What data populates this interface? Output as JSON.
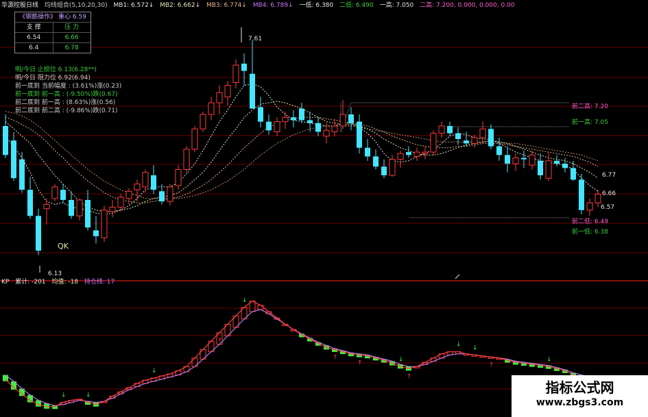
{
  "header": {
    "app": "华源控股日线",
    "formula": "均线组合(5,10,20,30)",
    "ma1": "MB1: 6.572↓",
    "ma2": "MB2: 6.662↓",
    "ma3": "MB3: 6.774↓",
    "ma4": "MB4: 6.789↓",
    "sup1": "一低: 6.380",
    "sup2": "二低: 6.490",
    "res1": "一高: 7.050",
    "res2": "二高: 7.200, 0.000, 0.000, 0.00"
  },
  "infobox": {
    "title": "《钢筋操作》 重心 6.59",
    "col_support": "支 撑",
    "col_pressure": "压 力",
    "rows": [
      [
        "6.54",
        "6.66"
      ],
      [
        "6.4",
        "6.78"
      ]
    ]
  },
  "notes": [
    {
      "text": "明/今日  止损位  6.13(6.28**)",
      "color": "#3ccf3c"
    },
    {
      "text": "明/今日  阻力位  6.92(6.94)",
      "color": "#d0d0d0"
    },
    {
      "text": "前一底到 当前幅度  : (3.61%)涨(0.23)",
      "color": "#d0d0d0"
    },
    {
      "text": "前一底到 前一高  : (-9.50%)跌(0.67)",
      "color": "#3ccf3c"
    },
    {
      "text": "前二底到 前一高  : (8.63%)涨(0.56)",
      "color": "#d0d0d0"
    },
    {
      "text": "前二底到 前二高  : (-9.86%)跌(0.71)",
      "color": "#d0d0d0"
    }
  ],
  "markers": {
    "peak": "7.61",
    "low": "6.13",
    "qk": "QK",
    "prev2_high": "前二高: 7.20",
    "prev1_high": "前一高: 7.05",
    "prev2_low": "前二低: 6.49",
    "prev1_low": "前一低: 6.38",
    "r1": "6.77",
    "r2": "6.66",
    "r3": "6.57"
  },
  "lower": {
    "name": "KP",
    "label1": "累计: -201",
    "label2": "均值: -18",
    "label3": "持仓线: 17"
  },
  "watermark": {
    "line1": "指标公式网",
    "line2": "www.zbgs3.com"
  },
  "colors": {
    "up": "#ff3c3c",
    "down": "#44e6ff",
    "ma_white": "#e6e6e6",
    "ma_yellow": "#e6e6b4",
    "ma_orange": "#e6b48c",
    "ma_brown": "#c88c64",
    "grid": "#6a0000",
    "osc_green": "#3cf03c",
    "osc_red": "#ff3c3c",
    "osc_purple": "#b478e6"
  },
  "chart_data": {
    "type": "candlestick",
    "ylim": [
      6.0,
      7.7
    ],
    "ohlc": [
      [
        7.02,
        7.1,
        6.8,
        6.82
      ],
      [
        6.92,
        6.98,
        6.64,
        6.66
      ],
      [
        6.79,
        6.84,
        6.56,
        6.58
      ],
      [
        6.58,
        6.67,
        6.38,
        6.4
      ],
      [
        6.4,
        6.45,
        6.13,
        6.16
      ],
      [
        6.45,
        6.52,
        6.34,
        6.48
      ],
      [
        6.52,
        6.62,
        6.5,
        6.6
      ],
      [
        6.58,
        6.62,
        6.49,
        6.51
      ],
      [
        6.51,
        6.57,
        6.38,
        6.4
      ],
      [
        6.4,
        6.52,
        6.37,
        6.51
      ],
      [
        6.51,
        6.58,
        6.3,
        6.32
      ],
      [
        6.3,
        6.4,
        6.21,
        6.26
      ],
      [
        6.25,
        6.47,
        6.22,
        6.44
      ],
      [
        6.43,
        6.51,
        6.39,
        6.46
      ],
      [
        6.46,
        6.55,
        6.43,
        6.53
      ],
      [
        6.52,
        6.59,
        6.48,
        6.57
      ],
      [
        6.58,
        6.65,
        6.5,
        6.62
      ],
      [
        6.6,
        6.72,
        6.56,
        6.7
      ],
      [
        6.68,
        6.75,
        6.55,
        6.58
      ],
      [
        6.57,
        6.62,
        6.48,
        6.5
      ],
      [
        6.5,
        6.62,
        6.47,
        6.6
      ],
      [
        6.61,
        6.75,
        6.58,
        6.72
      ],
      [
        6.72,
        6.88,
        6.7,
        6.86
      ],
      [
        6.86,
        7.02,
        6.84,
        7.0
      ],
      [
        7.0,
        7.12,
        6.98,
        7.1
      ],
      [
        7.1,
        7.22,
        7.06,
        7.18
      ],
      [
        7.18,
        7.3,
        7.1,
        7.25
      ],
      [
        7.22,
        7.33,
        7.16,
        7.3
      ],
      [
        7.32,
        7.48,
        7.28,
        7.44
      ],
      [
        7.45,
        7.52,
        7.3,
        7.4
      ],
      [
        7.38,
        7.61,
        7.3,
        7.14
      ],
      [
        7.15,
        7.22,
        7.01,
        7.05
      ],
      [
        7.05,
        7.1,
        6.96,
        6.99
      ],
      [
        6.98,
        7.08,
        6.95,
        7.05
      ],
      [
        7.05,
        7.12,
        7.0,
        7.08
      ],
      [
        7.08,
        7.13,
        7.01,
        7.06
      ],
      [
        7.14,
        7.18,
        7.04,
        7.06
      ],
      [
        7.06,
        7.12,
        6.98,
        7.04
      ],
      [
        7.04,
        7.08,
        6.95,
        6.98
      ],
      [
        6.95,
        7.04,
        6.9,
        6.99
      ],
      [
        6.98,
        7.07,
        6.95,
        7.02
      ],
      [
        7.02,
        7.2,
        7.0,
        7.1
      ],
      [
        7.1,
        7.15,
        6.99,
        7.04
      ],
      [
        7.05,
        7.1,
        6.83,
        6.87
      ],
      [
        6.87,
        6.93,
        6.78,
        6.81
      ],
      [
        6.81,
        6.86,
        6.72,
        6.74
      ],
      [
        6.74,
        6.79,
        6.66,
        6.68
      ],
      [
        6.68,
        6.82,
        6.67,
        6.79
      ],
      [
        6.79,
        6.85,
        6.73,
        6.83
      ],
      [
        6.84,
        6.88,
        6.8,
        6.82
      ],
      [
        6.81,
        6.87,
        6.78,
        6.84
      ],
      [
        6.83,
        6.88,
        6.79,
        6.84
      ],
      [
        6.84,
        6.99,
        6.82,
        6.97
      ],
      [
        6.97,
        7.05,
        6.94,
        7.02
      ],
      [
        7.02,
        7.05,
        6.95,
        6.97
      ],
      [
        6.97,
        7.01,
        6.89,
        6.93
      ],
      [
        6.92,
        6.98,
        6.88,
        6.9
      ],
      [
        6.9,
        6.96,
        6.87,
        6.94
      ],
      [
        6.94,
        7.05,
        6.9,
        7.0
      ],
      [
        7.0,
        7.03,
        6.86,
        6.88
      ],
      [
        6.88,
        6.94,
        6.78,
        6.82
      ],
      [
        6.82,
        6.88,
        6.7,
        6.76
      ],
      [
        6.76,
        6.83,
        6.71,
        6.8
      ],
      [
        6.8,
        6.85,
        6.73,
        6.79
      ],
      [
        6.75,
        6.85,
        6.72,
        6.82
      ],
      [
        6.78,
        6.83,
        6.65,
        6.68
      ],
      [
        6.66,
        6.84,
        6.64,
        6.78
      ],
      [
        6.78,
        6.82,
        6.74,
        6.76
      ],
      [
        6.76,
        6.8,
        6.7,
        6.73
      ],
      [
        6.73,
        6.78,
        6.64,
        6.65
      ],
      [
        6.65,
        6.69,
        6.41,
        6.44
      ],
      [
        6.44,
        6.52,
        6.4,
        6.49
      ],
      [
        6.49,
        6.58,
        6.46,
        6.55
      ]
    ],
    "ma_white": [
      6.95,
      6.88,
      6.8,
      6.7,
      6.58,
      6.5,
      6.48,
      6.49,
      6.46,
      6.45,
      6.44,
      6.42,
      6.41,
      6.42,
      6.44,
      6.47,
      6.52,
      6.58,
      6.6,
      6.6,
      6.6,
      6.63,
      6.69,
      6.76,
      6.85,
      6.95,
      7.05,
      7.13,
      7.22,
      7.3,
      7.31,
      7.29,
      7.23,
      7.15,
      7.1,
      7.06,
      7.05,
      7.04,
      7.03,
      7.02,
      7.02,
      7.04,
      7.04,
      7.01,
      6.97,
      6.91,
      6.83,
      6.78,
      6.77,
      6.78,
      6.81,
      6.83,
      6.86,
      6.9,
      6.95,
      6.97,
      6.96,
      6.94,
      6.93,
      6.93,
      6.9,
      6.87,
      6.84,
      6.82,
      6.8,
      6.78,
      6.77,
      6.76,
      6.75,
      6.72,
      6.66,
      6.61,
      6.57
    ],
    "ma_yellow": [
      7.05,
      7.0,
      6.95,
      6.9,
      6.82,
      6.75,
      6.68,
      6.62,
      6.56,
      6.5,
      6.46,
      6.44,
      6.43,
      6.43,
      6.44,
      6.45,
      6.47,
      6.5,
      6.52,
      6.53,
      6.54,
      6.56,
      6.6,
      6.65,
      6.7,
      6.77,
      6.85,
      6.93,
      7.0,
      7.08,
      7.13,
      7.17,
      7.18,
      7.19,
      7.18,
      7.16,
      7.14,
      7.11,
      7.08,
      7.05,
      7.04,
      7.03,
      7.03,
      7.02,
      7.0,
      6.97,
      6.93,
      6.9,
      6.87,
      6.85,
      6.83,
      6.82,
      6.82,
      6.83,
      6.85,
      6.87,
      6.89,
      6.9,
      6.91,
      6.92,
      6.91,
      6.9,
      6.88,
      6.86,
      6.84,
      6.82,
      6.8,
      6.79,
      6.78,
      6.76,
      6.73,
      6.7,
      6.66
    ],
    "ma_orange": [
      7.08,
      7.06,
      7.03,
      7.0,
      6.96,
      6.91,
      6.85,
      6.8,
      6.74,
      6.69,
      6.64,
      6.6,
      6.56,
      6.53,
      6.51,
      6.5,
      6.49,
      6.49,
      6.5,
      6.51,
      6.52,
      6.53,
      6.55,
      6.58,
      6.61,
      6.65,
      6.7,
      6.75,
      6.81,
      6.87,
      6.92,
      6.97,
      7.01,
      7.04,
      7.06,
      7.07,
      7.08,
      7.08,
      7.08,
      7.07,
      7.06,
      7.05,
      7.04,
      7.03,
      7.02,
      7.0,
      6.98,
      6.95,
      6.93,
      6.91,
      6.89,
      6.88,
      6.87,
      6.87,
      6.87,
      6.88,
      6.88,
      6.89,
      6.9,
      6.9,
      6.9,
      6.89,
      6.88,
      6.87,
      6.86,
      6.85,
      6.84,
      6.83,
      6.82,
      6.81,
      6.79,
      6.77,
      6.74
    ],
    "ma_brown": [
      7.12,
      7.11,
      7.09,
      7.06,
      7.02,
      6.97,
      6.92,
      6.87,
      6.82,
      6.77,
      6.72,
      6.68,
      6.64,
      6.61,
      6.58,
      6.56,
      6.54,
      6.52,
      6.52,
      6.52,
      6.52,
      6.52,
      6.53,
      6.54,
      6.56,
      6.58,
      6.61,
      6.64,
      6.68,
      6.72,
      6.77,
      6.82,
      6.86,
      6.9,
      6.93,
      6.96,
      6.98,
      7.0,
      7.01,
      7.02,
      7.02,
      7.02,
      7.02,
      7.01,
      7.0,
      6.99,
      6.98,
      6.97,
      6.96,
      6.95,
      6.94,
      6.93,
      6.92,
      6.91,
      6.91,
      6.91,
      6.91,
      6.91,
      6.91,
      6.91,
      6.91,
      6.9,
      6.9,
      6.89,
      6.88,
      6.87,
      6.86,
      6.85,
      6.84,
      6.83,
      6.82,
      6.8,
      6.78
    ],
    "osc": {
      "ylim": [
        -20,
        100
      ],
      "line_red": [
        10,
        2,
        -4,
        -10,
        -14,
        -16,
        -16,
        -12,
        -10,
        -9,
        -12,
        -14,
        -11,
        -6,
        -2,
        2,
        6,
        9,
        11,
        13,
        15,
        18,
        22,
        30,
        38,
        46,
        54,
        62,
        70,
        78,
        84,
        80,
        74,
        68,
        62,
        57,
        52,
        48,
        44,
        40,
        38,
        36,
        34,
        33,
        32,
        30,
        28,
        25,
        22,
        20,
        22,
        26,
        30,
        34,
        36,
        36,
        34,
        33,
        32,
        31,
        30,
        28,
        26,
        25,
        24,
        23,
        22,
        20,
        18,
        14,
        12,
        11,
        10
      ],
      "line_purple": [
        14,
        8,
        1,
        -5,
        -10,
        -13,
        -15,
        -14,
        -12,
        -10,
        -11,
        -12,
        -11,
        -8,
        -4,
        0,
        3,
        6,
        8,
        10,
        12,
        14,
        17,
        22,
        29,
        36,
        43,
        51,
        59,
        67,
        74,
        76,
        72,
        67,
        62,
        57,
        53,
        49,
        45,
        42,
        39,
        37,
        35,
        34,
        33,
        31,
        29,
        27,
        24,
        22,
        22,
        24,
        27,
        30,
        33,
        34,
        34,
        33,
        32,
        31,
        30,
        29,
        27,
        26,
        25,
        24,
        23,
        21,
        19,
        16,
        14,
        12,
        11
      ]
    }
  }
}
